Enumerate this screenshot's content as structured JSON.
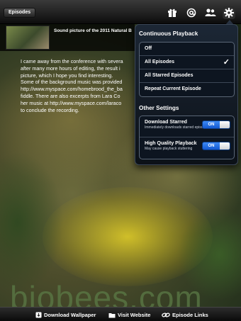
{
  "toolbar": {
    "back_label": "Episodes",
    "icons": [
      "gift-icon",
      "email-icon",
      "people-icon",
      "gear-icon"
    ]
  },
  "episode": {
    "title": "Sound picture of the 2011 Natural B",
    "description_lines": [
      "I came away from the conference with severa",
      "after many more hours of editing, the result i",
      "picture, which I hope you find interesting.",
      "Some of the background music was provided",
      "http://www.myspace.com/homebrood_the_ba",
      "fiddle. There are also excerpts from Lara Co",
      "her music at http://www.myspace.com/laraco",
      "to conclude the recording."
    ]
  },
  "popover": {
    "continuous_title": "Continuous Playback",
    "options": [
      {
        "label": "Off",
        "checked": false
      },
      {
        "label": "All Episodes",
        "checked": true
      },
      {
        "label": "All Starred Episodes",
        "checked": false
      },
      {
        "label": "Repeat Current Episode",
        "checked": false
      }
    ],
    "check_glyph": "✓",
    "other_title": "Other Settings",
    "settings": [
      {
        "label": "Download Starred",
        "sub": "Immediately downloads starred episodes",
        "state": "ON"
      },
      {
        "label": "High Quality Playback",
        "sub": "May cause playback stuttering",
        "state": "ON"
      }
    ]
  },
  "wallpaper_text": "biobees.com",
  "bottombar": {
    "download_wallpaper": "Download Wallpaper",
    "visit_website": "Visit Website",
    "episode_links": "Episode Links"
  },
  "colors": {
    "toggle_on": "#1e6ee8",
    "popover_bg": "#111a25"
  }
}
